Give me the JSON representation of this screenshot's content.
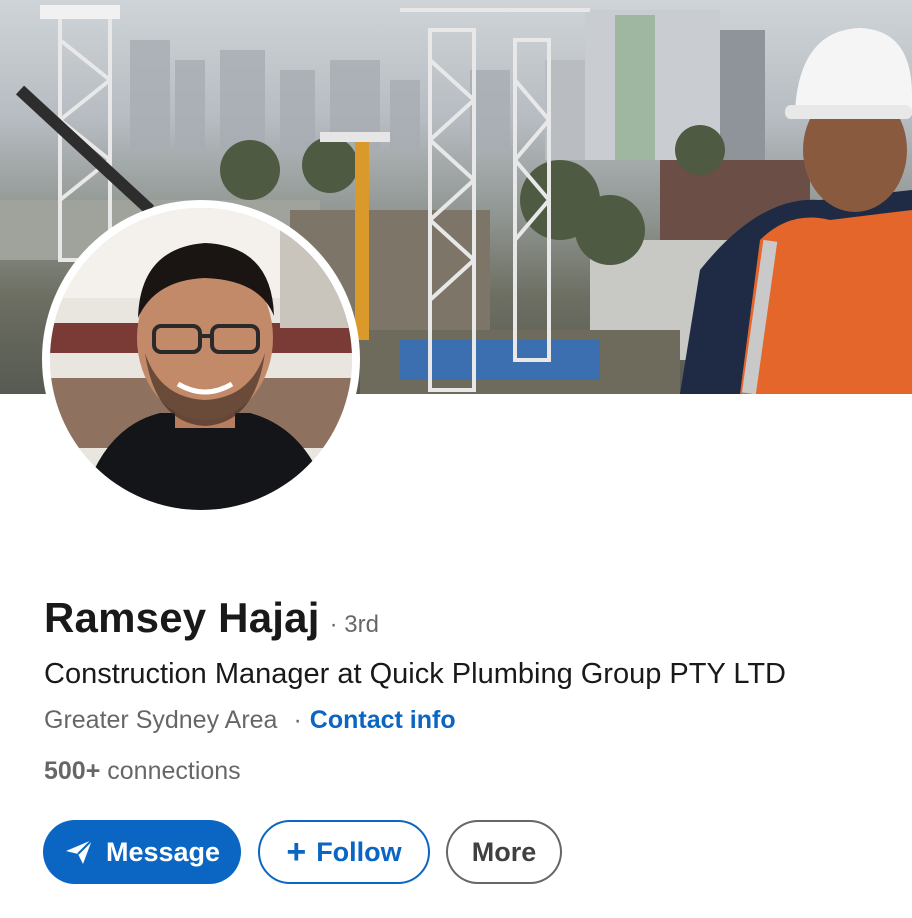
{
  "profile": {
    "name": "Ramsey Hajaj",
    "degree": "· 3rd",
    "headline": "Construction Manager at Quick Plumbing Group PTY LTD",
    "location": "Greater Sydney Area",
    "separator": "·",
    "contact_info": "Contact info",
    "connections_count": "500+",
    "connections_label": " connections"
  },
  "actions": {
    "message_label": "Message",
    "follow_label": "Follow",
    "follow_plus": "+",
    "more_label": "More"
  },
  "icons": {
    "message": "send-icon"
  },
  "colors": {
    "accent": "#0a66c2",
    "text_primary": "rgba(0,0,0,0.9)",
    "text_secondary": "rgba(0,0,0,0.6)"
  }
}
